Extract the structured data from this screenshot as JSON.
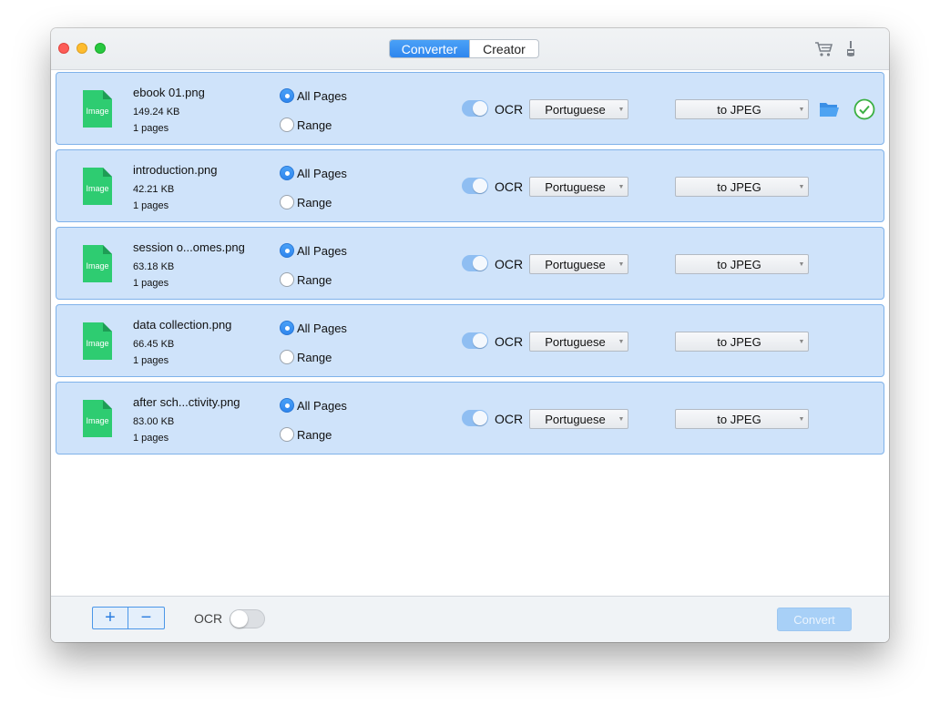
{
  "header": {
    "tabs": [
      {
        "label": "Converter",
        "active": true
      },
      {
        "label": "Creator",
        "active": false
      }
    ],
    "icons": [
      "cart-icon",
      "brush-icon"
    ]
  },
  "colors": {
    "accent": "#2f86ee",
    "row_bg": "#cfe3fa",
    "file_icon": "#2ecc71",
    "check": "#3cb043"
  },
  "files": [
    {
      "name": "ebook 01.png",
      "size": "149.24 KB",
      "pages": "1 pages",
      "file_badge": "Image",
      "page_mode_all": "All Pages",
      "page_mode_range": "Range",
      "selected": "all",
      "ocr_label": "OCR",
      "ocr_on": true,
      "language": "Portuguese",
      "format": "to JPEG",
      "done": true
    },
    {
      "name": "introduction.png",
      "size": "42.21 KB",
      "pages": "1 pages",
      "file_badge": "Image",
      "page_mode_all": "All Pages",
      "page_mode_range": "Range",
      "selected": "all",
      "ocr_label": "OCR",
      "ocr_on": true,
      "language": "Portuguese",
      "format": "to JPEG",
      "done": false
    },
    {
      "name": "session o...omes.png",
      "size": "63.18 KB",
      "pages": "1 pages",
      "file_badge": "Image",
      "page_mode_all": "All Pages",
      "page_mode_range": "Range",
      "selected": "all",
      "ocr_label": "OCR",
      "ocr_on": true,
      "language": "Portuguese",
      "format": "to JPEG",
      "done": false
    },
    {
      "name": "data collection.png",
      "size": "66.45 KB",
      "pages": "1 pages",
      "file_badge": "Image",
      "page_mode_all": "All Pages",
      "page_mode_range": "Range",
      "selected": "all",
      "ocr_label": "OCR",
      "ocr_on": true,
      "language": "Portuguese",
      "format": "to JPEG",
      "done": false
    },
    {
      "name": "after sch...ctivity.png",
      "size": "83.00 KB",
      "pages": "1 pages",
      "file_badge": "Image",
      "page_mode_all": "All Pages",
      "page_mode_range": "Range",
      "selected": "all",
      "ocr_label": "OCR",
      "ocr_on": true,
      "language": "Portuguese",
      "format": "to JPEG",
      "done": false
    }
  ],
  "footer": {
    "add_label": "+",
    "remove_label": "−",
    "ocr_label": "OCR",
    "ocr_on": false,
    "convert_label": "Convert"
  }
}
